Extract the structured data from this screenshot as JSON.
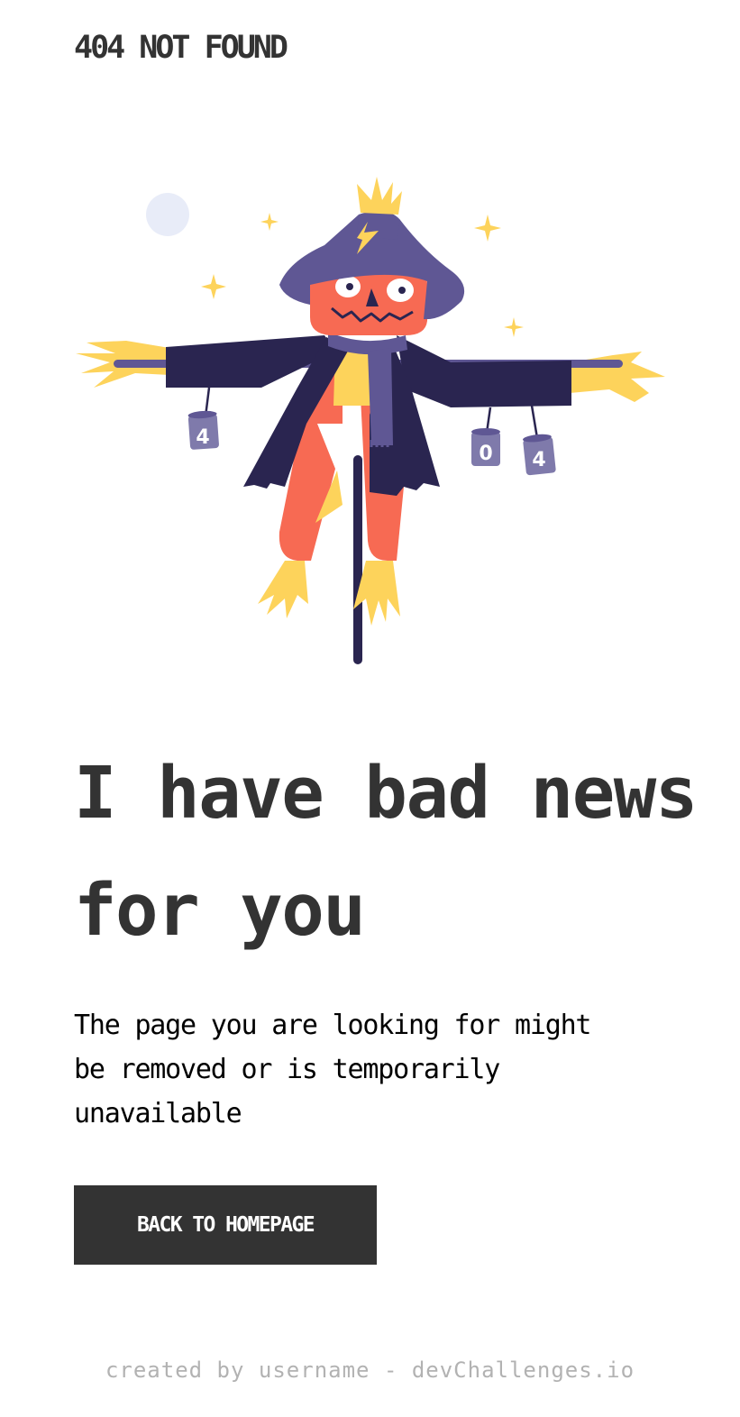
{
  "header": {
    "logo_text": "404 NOT FOUND"
  },
  "illustration": {
    "icon": "scarecrow-illustration",
    "can_labels": [
      "4",
      "0",
      "4"
    ],
    "colors": {
      "hat": "#5f5794",
      "coat": "#2a2550",
      "face": "#f76a53",
      "straw": "#fdd35b",
      "moon": "#e8ecf8"
    }
  },
  "main": {
    "headline": "I have bad news for you",
    "message": "The page you are looking for might be removed or is temporarily unavailable",
    "cta_label": "BACK TO HOMEPAGE"
  },
  "footer": {
    "credit": "created by username - devChallenges.io"
  },
  "colors": {
    "text": "#333333",
    "button_bg": "#333333",
    "button_text": "#ffffff",
    "footer_text": "#b2b2b2"
  }
}
